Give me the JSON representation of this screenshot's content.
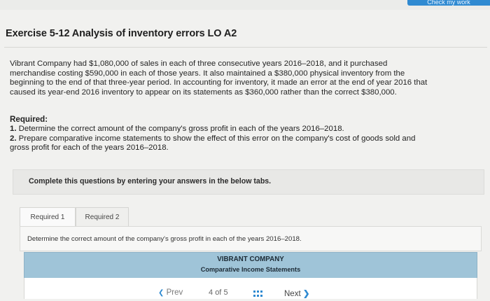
{
  "header": {
    "check_work_label": "Check my work"
  },
  "exercise": {
    "title": "Exercise 5-12 Analysis of inventory errors LO A2",
    "problem_lines": [
      "Vibrant Company had $1,080,000 of sales in each of three consecutive years 2016–2018, and it purchased",
      "merchandise costing $590,000 in each of those years. It also maintained a $380,000 physical inventory from the",
      "beginning to the end of that three-year period. In accounting for inventory, it made an error at the end of year 2016 that",
      "caused its year-end 2016 inventory to appear on its statements as $360,000 rather than the correct $380,000."
    ],
    "required_heading": "Required:",
    "requirements": [
      {
        "num": "1.",
        "lines": [
          "Determine the correct amount of the company's gross profit in each of the years 2016–2018."
        ]
      },
      {
        "num": "2.",
        "lines": [
          "Prepare comparative income statements to show the effect of this error on the company's cost of goods sold and",
          "gross profit for each of the years 2016–2018."
        ]
      }
    ]
  },
  "instructions": {
    "complete_text": "Complete this questions by entering your answers in the below tabs."
  },
  "tabs": [
    {
      "label": "Required 1",
      "active": true
    },
    {
      "label": "Required 2",
      "active": false
    }
  ],
  "tab_content": {
    "instruction": "Determine the correct amount of the company's gross profit in each of the years 2016–2018.",
    "company_name": "VIBRANT COMPANY",
    "statement_title": "Comparative Income Statements"
  },
  "pagination": {
    "prev_label": "Prev",
    "current_page": "4",
    "of_label": "of",
    "total_pages": "5",
    "next_label": "Next"
  },
  "colors": {
    "accent": "#2f8ad1",
    "statement_header_bg": "#9fc4d8"
  },
  "icons": {
    "prev": "chevron-left-icon",
    "next": "chevron-right-icon",
    "grid": "grid-icon"
  }
}
